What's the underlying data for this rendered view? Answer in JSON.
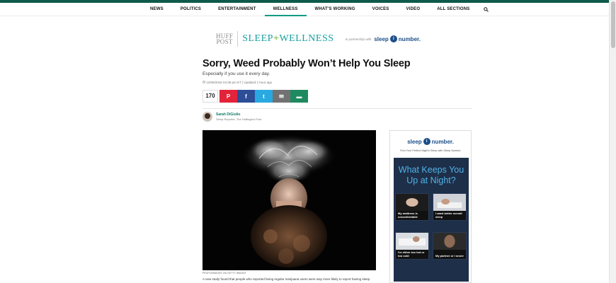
{
  "nav": {
    "items": [
      "NEWS",
      "POLITICS",
      "ENTERTAINMENT",
      "WELLNESS",
      "WHAT'S WORKING",
      "VOICES",
      "VIDEO",
      "ALL SECTIONS"
    ],
    "active": "WELLNESS"
  },
  "brand": {
    "huff": "HUFF",
    "post": "POST",
    "section_left": "SLEEP",
    "section_plus": "+",
    "section_right": "WELLNESS",
    "partner_text": "In partnership with",
    "sleep_word": "sleep",
    "number_word": "number.",
    "dot_text": "i"
  },
  "article": {
    "headline": "Sorry, Weed Probably Won’t Help You Sleep",
    "subhead": "Especially if you use it every day.",
    "timestamp": "12/06/2016 04:38 pm ET | Updated 1 hour ago",
    "share_count": "170",
    "author_name": "Sarah DiGiulio",
    "author_role": "Sleep Reporter, The Huffington Post",
    "image_credit": "PEOPLEIMAGES VIA GETTY IMAGES",
    "body": "A new study found that people who reported being regular marijuana users were way more likely to report having sleep"
  },
  "share": {
    "buttons": [
      {
        "name": "pinterest",
        "glyph": "P",
        "color": "#e2233a"
      },
      {
        "name": "facebook",
        "glyph": "f",
        "color": "#2d4e97"
      },
      {
        "name": "twitter",
        "glyph": "t",
        "color": "#28a9e1"
      },
      {
        "name": "email",
        "glyph": "✉",
        "color": "#727272"
      },
      {
        "name": "comment",
        "glyph": "▬",
        "color": "#1f8a5f"
      }
    ]
  },
  "ad": {
    "brand_sleep": "sleep",
    "brand_number": "number.",
    "dot_text": "i",
    "tagline": "Find Your Perfect Night's Sleep with Sleep Number",
    "question": "What Keeps You Up at Night?",
    "tiles": [
      "My mattress is uncomfortable",
      "I want better overall sleep",
      "I'm either too hot or too cold",
      "My partner or I snore"
    ]
  }
}
